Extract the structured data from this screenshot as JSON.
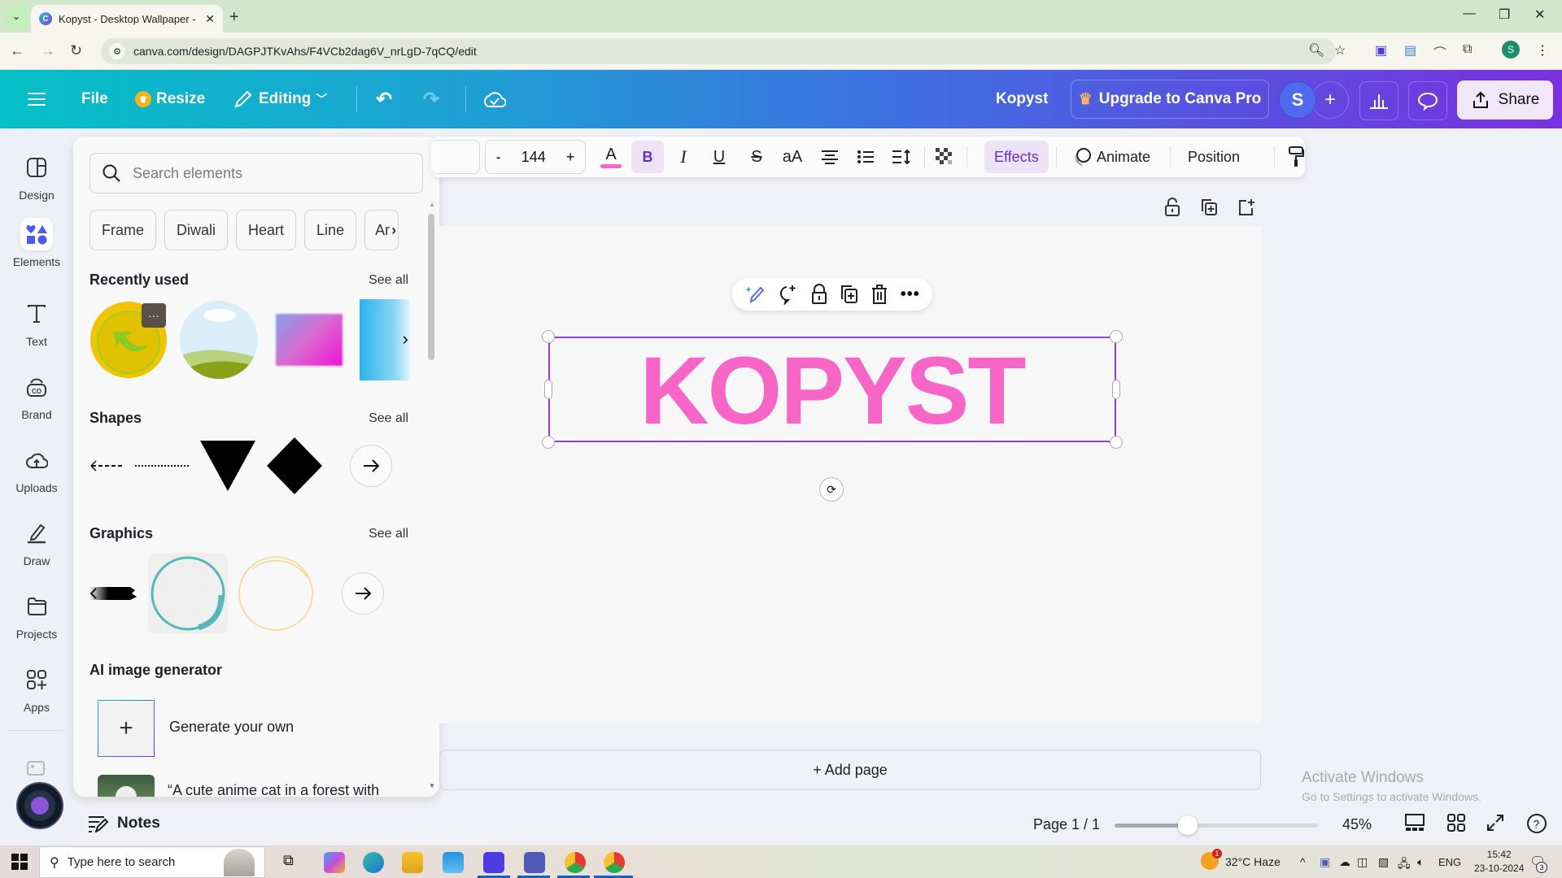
{
  "browser": {
    "tab_title": "Kopyst - Desktop Wallpaper - C",
    "url": "canva.com/design/DAGPJTKvAhs/F4VCb2dag6V_nrLgD-7qCQ/edit",
    "profile_initial": "S"
  },
  "header": {
    "file_label": "File",
    "resize_label": "Resize",
    "editing_label": "Editing",
    "doc_title": "Kopyst",
    "upgrade_label": "Upgrade to Canva Pro",
    "avatar_initial": "S",
    "share_label": "Share"
  },
  "rail": {
    "items": [
      {
        "label": "Design",
        "icon": "layout-icon"
      },
      {
        "label": "Elements",
        "icon": "shapes-icon",
        "active": true
      },
      {
        "label": "Text",
        "icon": "text-icon"
      },
      {
        "label": "Brand",
        "icon": "brand-icon"
      },
      {
        "label": "Uploads",
        "icon": "cloud-upload-icon"
      },
      {
        "label": "Draw",
        "icon": "pen-icon"
      },
      {
        "label": "Projects",
        "icon": "folder-icon"
      },
      {
        "label": "Apps",
        "icon": "apps-icon"
      }
    ]
  },
  "panel": {
    "search_placeholder": "Search elements",
    "chips": [
      "Frame",
      "Diwali",
      "Heart",
      "Line",
      "Ar"
    ],
    "sections": {
      "recent": {
        "title": "Recently used",
        "see_all": "See all"
      },
      "shapes": {
        "title": "Shapes",
        "see_all": "See all"
      },
      "graphics": {
        "title": "Graphics",
        "see_all": "See all"
      },
      "ai": {
        "title": "AI image generator",
        "generate_label": "Generate your own",
        "sample_prompt": "“A cute anime cat in a forest with"
      }
    }
  },
  "toolbar": {
    "font_size": "144",
    "minus": "-",
    "plus": "+",
    "bold": "B",
    "italic": "I",
    "underline": "U",
    "strike": "S",
    "case": "aA",
    "effects_label": "Effects",
    "animate_label": "Animate",
    "position_label": "Position",
    "text_color": "#f765c6"
  },
  "canvas": {
    "text": "KOPYST",
    "text_color": "#f765c6",
    "selection_color": "#8b3dff",
    "add_page_label": "+ Add page"
  },
  "footer": {
    "notes_label": "Notes",
    "page_indicator": "Page 1 / 1",
    "zoom_percent": "45%",
    "zoom_slider_fraction": 0.36
  },
  "watermark": {
    "line1": "Activate Windows",
    "line2": "Go to Settings to activate Windows."
  },
  "taskbar": {
    "search_placeholder": "Type here to search",
    "weather": "32°C  Haze",
    "language": "ENG",
    "time": "15:42",
    "date": "23-10-2024",
    "notification_count": "3",
    "weather_badge": "1"
  }
}
